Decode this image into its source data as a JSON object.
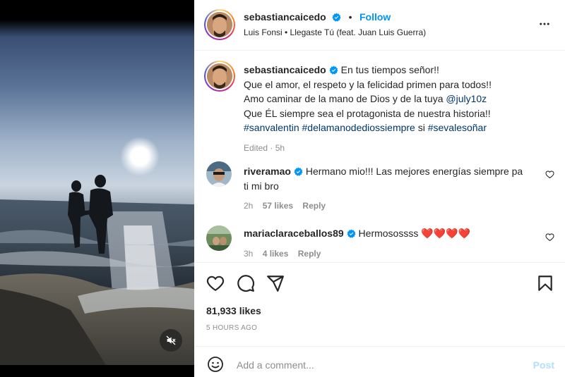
{
  "post": {
    "author": "sebastiancaicedo",
    "follow_label": "Follow",
    "dot": "•",
    "audio": "Luis Fonsi • Llegaste Tú (feat. Juan Luis Guerra)"
  },
  "caption": {
    "author": "sebastiancaicedo",
    "line1": "En tus tiempos señor!!",
    "line2": "Que el amor, el respeto y la felicidad primen para todos!!",
    "line3_text": "Amo caminar de la mano de Dios y de la tuya ",
    "line3_mention": "@july10z",
    "line4": "Que ÉL siempre sea el protagonista de nuestra historia!!",
    "hashtag1": "#sanvalentin",
    "hashtag2": "#delamanodediossiempre",
    "connector": " si ",
    "hashtag3": "#sevalesoñar",
    "edited": "Edited · 5h"
  },
  "comments": [
    {
      "user": "riveramao",
      "text": "Hermano mio!!! Las mejores energías siempre pa",
      "text2": "ti mi bro",
      "time": "2h",
      "likes": "57 likes",
      "reply": "Reply"
    },
    {
      "user": "mariaclaraceballos89",
      "text": "Hermosossss ❤️❤️❤️❤️",
      "time": "3h",
      "likes": "4 likes",
      "reply": "Reply"
    }
  ],
  "stats": {
    "likes": "81,933 likes",
    "posted": "5 HOURS AGO"
  },
  "composer": {
    "placeholder": "Add a comment...",
    "post_label": "Post"
  },
  "colors": {
    "accent": "#0095f6",
    "verified": "#0095f6",
    "muted": "#8e8e8e",
    "post_disabled": "#b2dffc"
  },
  "icons": [
    "more-icon",
    "verified-icon",
    "heart-icon",
    "comment-icon",
    "share-icon",
    "bookmark-icon",
    "emoji-icon",
    "mute-icon"
  ]
}
